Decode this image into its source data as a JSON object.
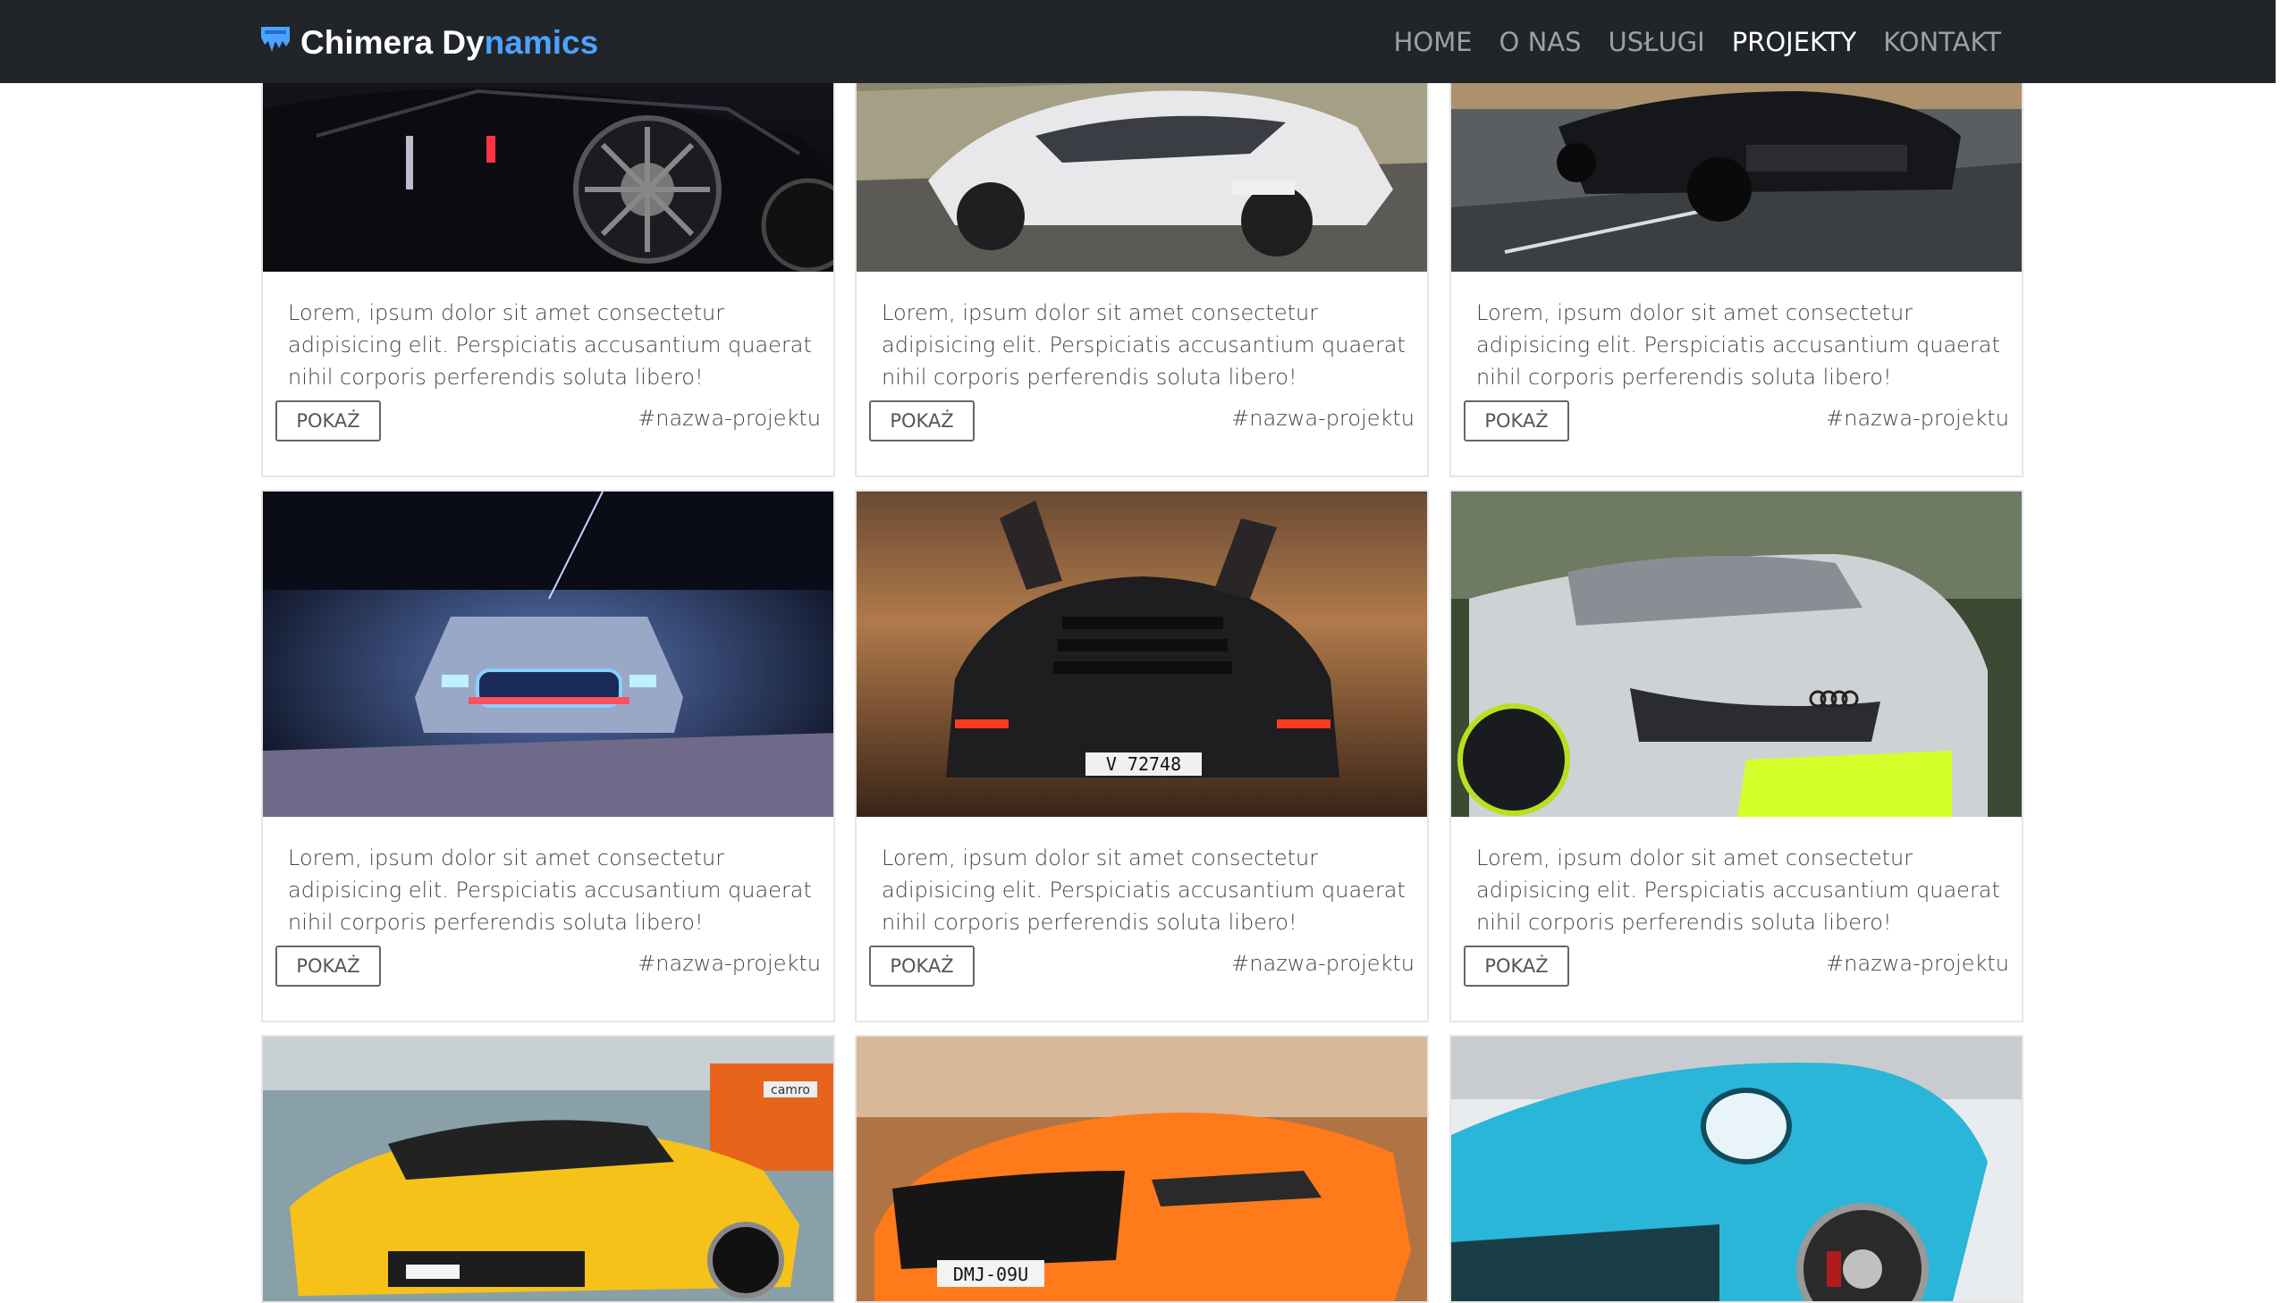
{
  "brand": {
    "name_part1": "Chimera Dy",
    "name_part2": "namics"
  },
  "nav": {
    "items": [
      {
        "label": "HOME"
      },
      {
        "label": "O NAS"
      },
      {
        "label": "USŁUGI"
      },
      {
        "label": "PROJEKTY"
      },
      {
        "label": "KONTAKT"
      }
    ],
    "active": "PROJEKTY"
  },
  "cards": [
    {
      "image": "car-black-camaro-photo",
      "text": "Lorem, ipsum dolor sit amet consectetur adipisicing elit. Perspiciatis accusantium quaerat nihil corporis perferendis soluta libero!",
      "button": "POKAŻ",
      "tag": "#nazwa-projektu"
    },
    {
      "image": "car-white-mclaren-photo",
      "text": "Lorem, ipsum dolor sit amet consectetur adipisicing elit. Perspiciatis accusantium quaerat nihil corporis perferendis soluta libero!",
      "button": "POKAŻ",
      "tag": "#nazwa-projektu"
    },
    {
      "image": "car-black-mustang-photo",
      "text": "Lorem, ipsum dolor sit amet consectetur adipisicing elit. Perspiciatis accusantium quaerat nihil corporis perferendis soluta libero!",
      "button": "POKAŻ",
      "tag": "#nazwa-projektu"
    },
    {
      "image": "car-blue-lit-mustang-photo",
      "text": "Lorem, ipsum dolor sit amet consectetur adipisicing elit. Perspiciatis accusantium quaerat nihil corporis perferendis soluta libero!",
      "button": "POKAŻ",
      "tag": "#nazwa-projektu"
    },
    {
      "image": "car-lamborghini-rear-photo",
      "text": "Lorem, ipsum dolor sit amet consectetur adipisicing elit. Perspiciatis accusantium quaerat nihil corporis perferendis soluta libero!",
      "button": "POKAŻ",
      "tag": "#nazwa-projektu",
      "plate": "V 72748"
    },
    {
      "image": "car-white-audi-r8-photo",
      "text": "Lorem, ipsum dolor sit amet consectetur adipisicing elit. Perspiciatis accusantium quaerat nihil corporis perferendis soluta libero!",
      "button": "POKAŻ",
      "tag": "#nazwa-projektu"
    },
    {
      "image": "car-yellow-camaro-photo",
      "sign": "camro"
    },
    {
      "image": "car-orange-mustang-photo",
      "plate": "DMJ-09U"
    },
    {
      "image": "car-teal-porsche-photo"
    }
  ],
  "colors": {
    "navbar_bg": "#212529",
    "brand_accent": "#4da3ff",
    "nav_inactive": "#9da0a3",
    "nav_active": "#ffffff"
  }
}
